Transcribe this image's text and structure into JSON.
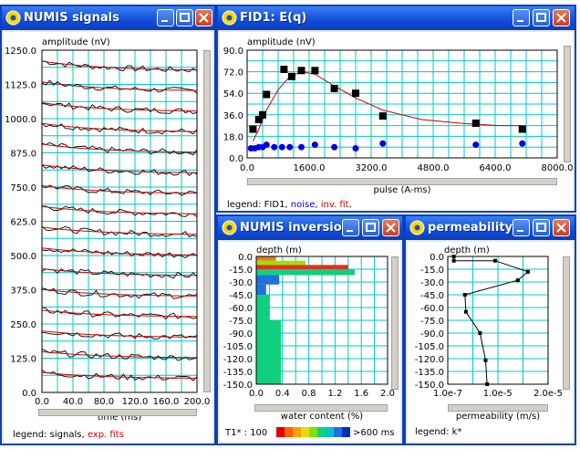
{
  "colors": {
    "grid": "#00c8c8",
    "signal": "#000000",
    "fit": "#d00000",
    "data": "#000000",
    "noise": "#0000e0",
    "bars": "#10d080"
  },
  "windows": {
    "signals": {
      "title": "NUMIS signals",
      "ylabel": "amplitude (nV)",
      "xlabel": "time (ms)",
      "yticks": [
        "1250.0",
        "1125.0",
        "1000.0",
        "875.0",
        "750.0",
        "625.0",
        "500.0",
        "375.0",
        "250.0",
        "125.0",
        "0.0"
      ],
      "xticks": [
        "0.0",
        "40.0",
        "80.0",
        "120.0",
        "160.0",
        "200.0"
      ],
      "legend_prefix": "legend: signals, ",
      "legend_fits": "exp. fits"
    },
    "fid": {
      "title": "FID1: E(q)",
      "ylabel": "amplitude (nV)",
      "xlabel": "pulse (A-ms)",
      "yticks": [
        "90.0",
        "72.0",
        "54.0",
        "36.0",
        "18.0",
        "0.0"
      ],
      "xticks": [
        "0.0",
        "1600.0",
        "3200.0",
        "4800.0",
        "6400.0",
        "8000.0"
      ],
      "legend_prefix": "legend: FID1, ",
      "legend_noise": "noise, ",
      "legend_inv": "inv. fit,"
    },
    "inversion": {
      "title": "NUMIS inversion",
      "ylabel": "depth (m)",
      "xlabel": "water content (%)",
      "yticks": [
        "0.0",
        "-15.0",
        "-30.0",
        "-45.0",
        "-60.0",
        "-75.0",
        "-90.0",
        "-105.0",
        "-120.0",
        "-135.0",
        "-150.0"
      ],
      "xticks": [
        "0.0",
        "0.4",
        "0.8",
        "1.2",
        "1.6",
        "2.0"
      ],
      "t1_label": "T1* : 100",
      "t1_max": ">600 ms"
    },
    "perm": {
      "title": "permeability",
      "ylabel": "depth (m)",
      "xlabel": "permeability (m/s)",
      "yticks": [
        "0.0",
        "-15.0",
        "-30.0",
        "-45.0",
        "-60.0",
        "-75.0",
        "-90.0",
        "-105.0",
        "-120.0",
        "-135.0",
        "-150.0"
      ],
      "xticks": [
        "1.0e-7",
        "1.0e-5",
        "2.0e-5"
      ],
      "legend": "legend: k*"
    }
  },
  "chart_data": [
    {
      "type": "line",
      "title": "",
      "xlabel": "time (ms)",
      "ylabel": "amplitude (nV)",
      "xlim": [
        0,
        200
      ],
      "ylim": [
        0,
        1250
      ],
      "series": [
        {
          "name": "signals",
          "offsets": [
            1175,
            1100,
            1025,
            950,
            875,
            800,
            725,
            650,
            575,
            500,
            425,
            350,
            275,
            200,
            125,
            50
          ]
        },
        {
          "name": "exp. fits"
        }
      ]
    },
    {
      "type": "scatter",
      "title": "",
      "xlabel": "pulse (A-ms)",
      "ylabel": "amplitude (nV)",
      "xlim": [
        0,
        8000
      ],
      "ylim": [
        0,
        90
      ],
      "series": [
        {
          "name": "FID1",
          "x": [
            150,
            300,
            400,
            500,
            950,
            1150,
            1400,
            1750,
            2250,
            2800,
            3500,
            5900,
            7100
          ],
          "y": [
            24,
            32,
            36,
            53,
            74,
            68,
            73,
            73,
            58,
            54,
            35,
            29,
            24
          ]
        },
        {
          "name": "noise",
          "x": [
            100,
            200,
            300,
            400,
            500,
            700,
            900,
            1100,
            1400,
            1750,
            2250,
            2800,
            3500,
            5900,
            7100
          ],
          "y": [
            8,
            8,
            9,
            9,
            11,
            9,
            9,
            9,
            9,
            11,
            9,
            8,
            12,
            11,
            12
          ]
        },
        {
          "name": "inv. fit",
          "x": [
            150,
            300,
            500,
            800,
            1100,
            1400,
            1750,
            2200,
            2800,
            3500,
            4500,
            5500,
            6500,
            7100
          ],
          "y": [
            14,
            24,
            40,
            57,
            68,
            72,
            70,
            61,
            50,
            40,
            32,
            29,
            27,
            27
          ]
        }
      ]
    },
    {
      "type": "bar",
      "title": "",
      "xlabel": "water content (%)",
      "ylabel": "depth (m)",
      "xlim": [
        0,
        2.0
      ],
      "ylim": [
        -150,
        0
      ],
      "layers": [
        {
          "top": 0,
          "bottom": -5,
          "value": 0.3,
          "color": "#e08020"
        },
        {
          "top": -5,
          "bottom": -10,
          "value": 0.75,
          "color": "#a0e000"
        },
        {
          "top": -10,
          "bottom": -15,
          "value": 1.4,
          "color": "#e03020"
        },
        {
          "top": -15,
          "bottom": -22,
          "value": 1.5,
          "color": "#10d080"
        },
        {
          "top": -22,
          "bottom": -33,
          "value": 0.35,
          "color": "#2070e0"
        },
        {
          "top": -33,
          "bottom": -45,
          "value": 0.15,
          "color": "#2070e0"
        },
        {
          "top": -45,
          "bottom": -75,
          "value": 0.2,
          "color": "#10d080"
        },
        {
          "top": -75,
          "bottom": -150,
          "value": 0.38,
          "color": "#10d080"
        }
      ]
    },
    {
      "type": "line",
      "title": "",
      "xlabel": "permeability (m/s)",
      "ylabel": "depth (m)",
      "xlim": [
        1e-07,
        2e-05
      ],
      "ylim": [
        -150,
        0
      ],
      "series": [
        {
          "name": "k*",
          "x": [
            1.3e-06,
            1.3e-06,
            9.5e-06,
            1.6e-05,
            1.4e-05,
            3.5e-06,
            3.7e-06,
            6.5e-06,
            7.6e-06,
            7.9e-06
          ],
          "y": [
            0,
            -5,
            -5,
            -18,
            -28,
            -45,
            -65,
            -90,
            -122,
            -150
          ]
        }
      ]
    }
  ]
}
